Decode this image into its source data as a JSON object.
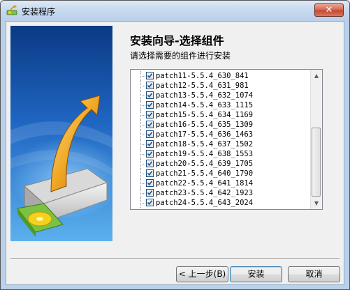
{
  "window": {
    "title": "安装程序",
    "close_label": "✕"
  },
  "header": {
    "heading": "安装向导-选择组件",
    "subheading": "请选择需要的组件进行安装"
  },
  "components": [
    {
      "label": "patch11-5.5.4_630_841",
      "checked": true
    },
    {
      "label": "patch12-5.5.4_631_981",
      "checked": true
    },
    {
      "label": "patch13-5.5.4_632_1074",
      "checked": true
    },
    {
      "label": "patch14-5.5.4_633_1115",
      "checked": true
    },
    {
      "label": "patch15-5.5.4_634_1169",
      "checked": true
    },
    {
      "label": "patch16-5.5.4_635_1309",
      "checked": true
    },
    {
      "label": "patch17-5.5.4_636_1463",
      "checked": true
    },
    {
      "label": "patch18-5.5.4_637_1502",
      "checked": true
    },
    {
      "label": "patch19-5.5.4_638_1553",
      "checked": true
    },
    {
      "label": "patch20-5.5.4_639_1705",
      "checked": true
    },
    {
      "label": "patch21-5.5.4_640_1790",
      "checked": true
    },
    {
      "label": "patch22-5.5.4_641_1814",
      "checked": true
    },
    {
      "label": "patch23-5.5.4_642_1923",
      "checked": true
    },
    {
      "label": "patch24-5.5.4_643_2024",
      "checked": true
    }
  ],
  "buttons": {
    "back": "< 上一步(B)",
    "install": "安装",
    "cancel": "取消"
  },
  "icons": {
    "app": "installer-icon",
    "banner": "disk-drive-arrow-icon",
    "scroll_up": "▲",
    "scroll_down": "▼"
  },
  "colors": {
    "banner_top": "#0d3f8a",
    "banner_bottom": "#4da5e8",
    "arrow": "#e8a020",
    "drive_green": "#7cc242",
    "disc_yellow": "#f2d21c"
  }
}
